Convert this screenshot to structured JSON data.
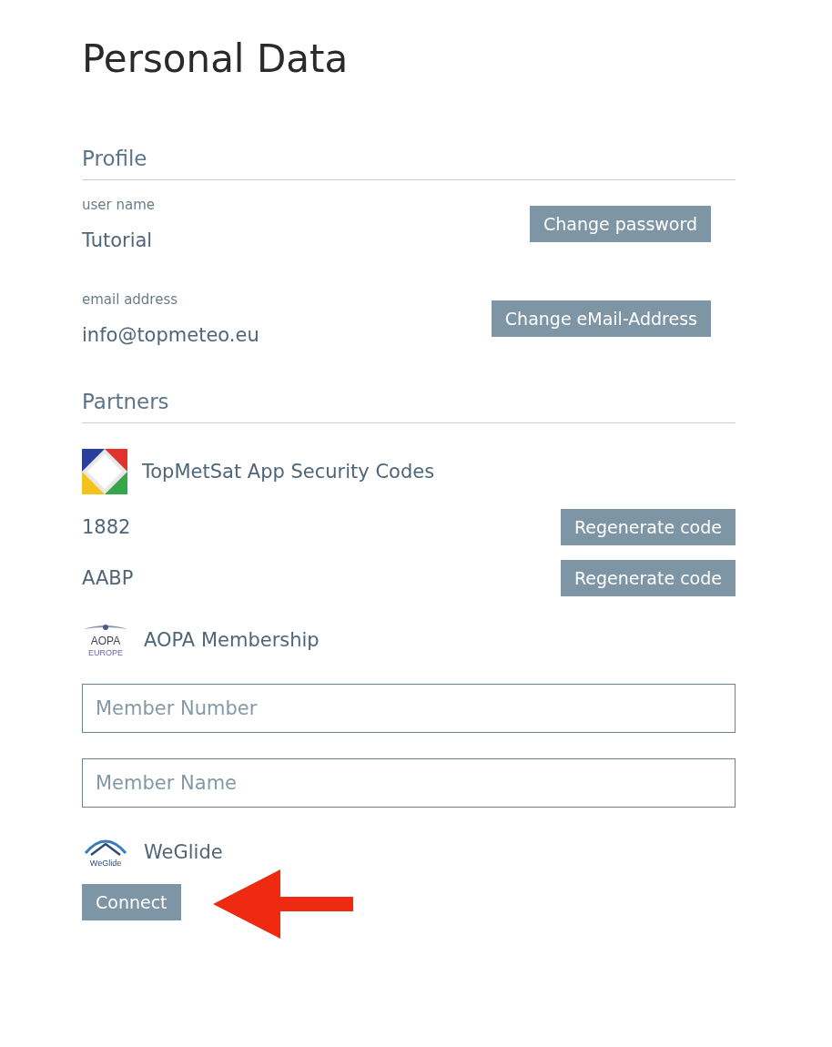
{
  "page_title": "Personal Data",
  "profile": {
    "heading": "Profile",
    "fields": [
      {
        "label": "user name",
        "value": "Tutorial",
        "button": "Change password"
      },
      {
        "label": "email address",
        "value": "info@topmeteo.eu",
        "button": "Change eMail-Address"
      }
    ]
  },
  "partners": {
    "heading": "Partners",
    "items": [
      {
        "kind": "tilelogo",
        "title": "TopMetSat App Security Codes"
      },
      {
        "kind": "code",
        "code": "1882",
        "button": "Regenerate code"
      },
      {
        "kind": "code",
        "code": "AABP",
        "button": "Regenerate code"
      },
      {
        "kind": "winglogo",
        "logo_text": [
          "AOPA",
          "EUROPE"
        ],
        "title": "AOPA Membership"
      },
      {
        "kind": "input",
        "placeholder": "Member Number"
      },
      {
        "kind": "input",
        "placeholder": "Member Name"
      },
      {
        "kind": "archlogo",
        "logo_text": [
          "WeGlide"
        ],
        "title": "WeGlide"
      },
      {
        "kind": "button",
        "label": "Connect"
      }
    ]
  }
}
